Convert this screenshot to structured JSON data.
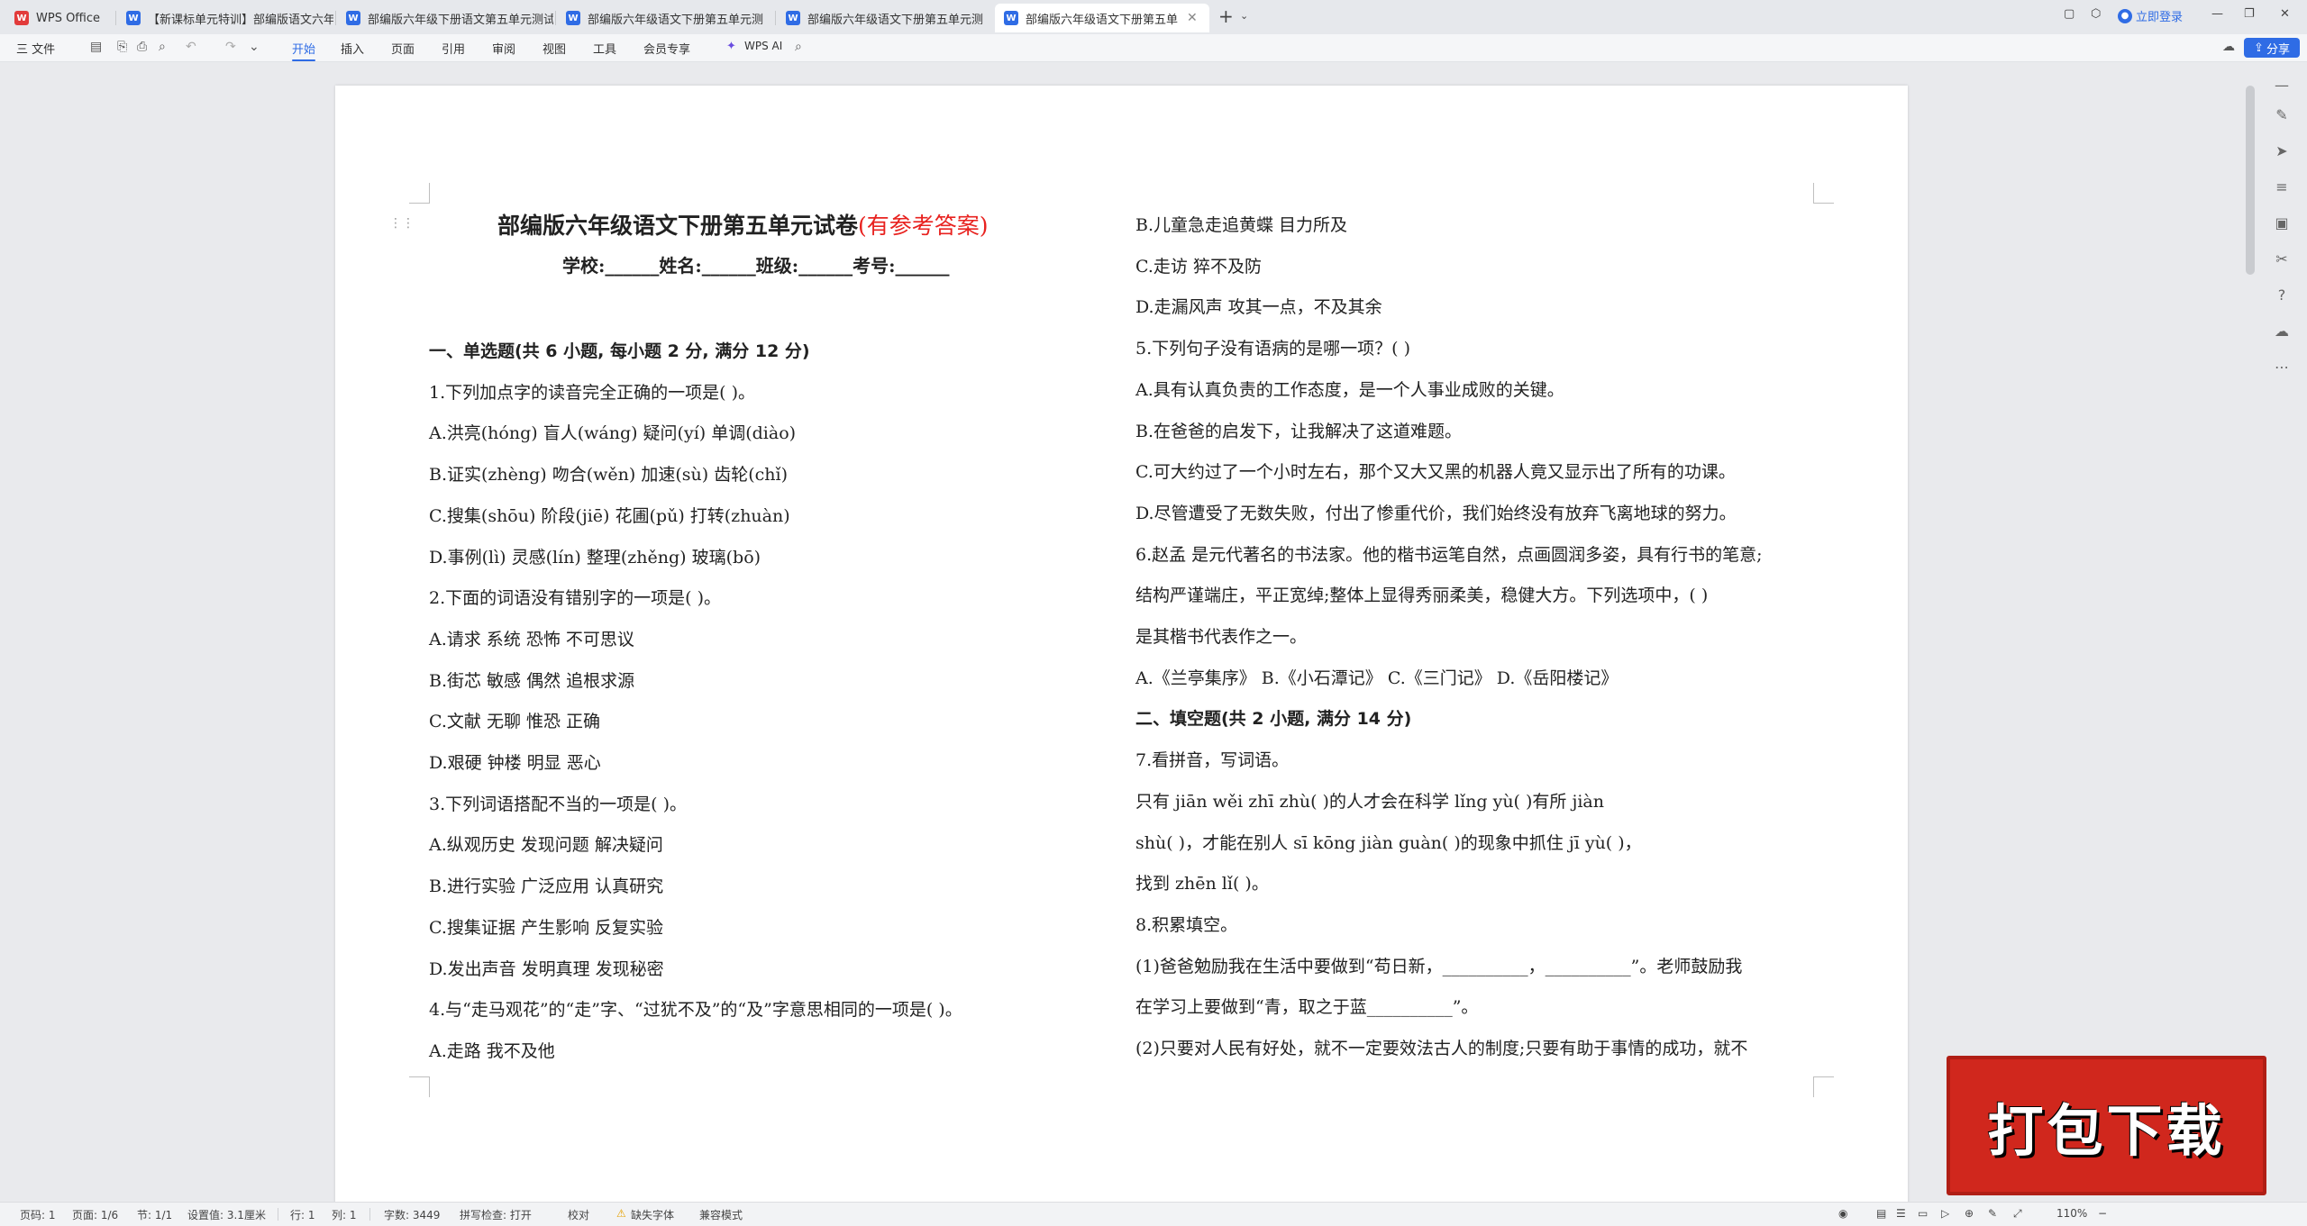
{
  "tabs": [
    {
      "label": "WPS Office",
      "icon": "wps-logo-icon",
      "active": false
    },
    {
      "label": "【新课标单元特训】部编版语文六年",
      "icon": "word-doc-icon",
      "active": false
    },
    {
      "label": "部编版六年级下册语文第五单元测试",
      "icon": "word-doc-icon",
      "active": false
    },
    {
      "label": "部编版六年级语文下册第五单元测",
      "icon": "word-doc-icon",
      "active": false
    },
    {
      "label": "部编版六年级语文下册第五单元测",
      "icon": "word-doc-icon",
      "active": false
    },
    {
      "label": "部编版六年级语文下册第五单",
      "icon": "word-doc-icon",
      "active": true
    }
  ],
  "account": {
    "login_label": "立即登录"
  },
  "menu": {
    "file_label": "三 文件",
    "items": [
      "开始",
      "插入",
      "页面",
      "引用",
      "审阅",
      "视图",
      "工具",
      "会员专享"
    ],
    "ai_label": "WPS AI",
    "share_label": "分享"
  },
  "document": {
    "title": "部编版六年级语文下册第五单元试卷",
    "title_note": "(有参考答案)",
    "student_info": "学校:______姓名:______班级:______考号:______",
    "left_lines": [
      "一、单选题(共 6 小题, 每小题 2 分, 满分 12 分)",
      "1.下列加点字的读音完全正确的一项是(        )。",
      "A.洪亮(hóng)      盲人(wáng)      疑问(yí)           单调(diào)",
      "B.证实(zhèng)      吻合(wěn)      加速(sù)           齿轮(chǐ)",
      "C.搜集(shōu)       阶段(jiē)      花圃(pǔ)           打转(zhuàn)",
      "D.事例(lì)          灵感(lín)      整理(zhěng)      玻璃(bō)",
      "2.下面的词语没有错别字的一项是(        )。",
      "A.请求       系统       恐怖       不可思议",
      "B.街芯       敏感       偶然       追根求源",
      "C.文献       无聊       惟恐       正确",
      "D.艰硬       钟楼       明显       恶心",
      "3.下列词语搭配不当的一项是(        )。",
      "A.纵观历史       发现问题       解决疑问",
      "B.进行实验       广泛应用       认真研究",
      "C.搜集证据       产生影响       反复实验",
      "D.发出声音       发明真理       发现秘密",
      "4.与“走马观花”的“走”字、“过犹不及”的“及”字意思相同的一项是(        )。",
      "A.走路                                   我不及他"
    ],
    "right_lines": [
      "B.儿童急走追黄蝶         目力所及",
      "C.走访                                   猝不及防",
      "D.走漏风声                            攻其一点，不及其余",
      "5.下列句子没有语病的是哪一项？(          )",
      "A.具有认真负责的工作态度，是一个人事业成败的关键。",
      "B.在爸爸的启发下，让我解决了这道难题。",
      "C.可大约过了一个小时左右，那个又大又黑的机器人竟又显示出了所有的功课。",
      "D.尽管遭受了无数失败，付出了惨重代价，我们始终没有放弃飞离地球的努力。",
      "6.赵孟    是元代著名的书法家。他的楷书运笔自然，点画圆润多姿，具有行书的笔意;",
      "结构严谨端庄，平正宽绰;整体上显得秀丽柔美，稳健大方。下列选项中，(          )",
      "是其楷书代表作之一。",
      "A.《兰亭集序》      B.《小石潭记》      C.《三门记》       D.《岳阳楼记》",
      "二、填空题(共 2 小题, 满分 14 分)",
      "7.看拼音，写词语。",
      "        只有 jiān wěi zhī zhù(        )的人才会在科学 lǐng yù(        )有所 jiàn",
      "shù(        )，才能在别人 sī kōng jiàn guàn(        )的现象中抓住 jī yù(        )，",
      "找到 zhēn lǐ(        )。",
      "8.积累填空。",
      "(1)爸爸勉励我在生活中要做到“苟日新，__________，__________”。老师鼓励我",
      "在学习上要做到“青，取之于蓝__________”。",
      "(2)只要对人民有好处，就不一定要效法古人的制度;只要有助于事情的成功，就不"
    ]
  },
  "status": {
    "page_no": "页码: 1",
    "page_of": "页面: 1/6",
    "section": "节: 1/1",
    "setting": "设置值: 3.1厘米",
    "row": "行: 1",
    "col": "列: 1",
    "word_count": "字数: 3449",
    "spell_check": "拼写检查: 打开",
    "proof": "校对",
    "missing_font": "缺失字体",
    "compat": "兼容模式",
    "zoom": "110%"
  },
  "banner": {
    "text": "打包下载"
  }
}
